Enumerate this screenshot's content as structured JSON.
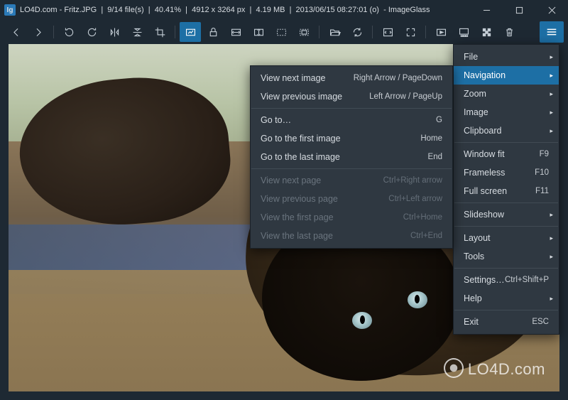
{
  "titlebar": {
    "site": "LO4D.com",
    "filename": "Fritz.JPG",
    "file_pos": "9/14 file(s)",
    "zoom": "40.41%",
    "dimensions": "4912 x 3264 px",
    "filesize": "4.19 MB",
    "datetime": "2013/06/15 08:27:01 (o)",
    "appname": "ImageGlass"
  },
  "main_menu": [
    {
      "label": "File",
      "arrow": true
    },
    {
      "label": "Navigation",
      "arrow": true,
      "selected": true
    },
    {
      "label": "Zoom",
      "arrow": true
    },
    {
      "label": "Image",
      "arrow": true
    },
    {
      "label": "Clipboard",
      "arrow": true
    },
    {
      "sep": true
    },
    {
      "label": "Window fit",
      "shortcut": "F9"
    },
    {
      "label": "Frameless",
      "shortcut": "F10"
    },
    {
      "label": "Full screen",
      "shortcut": "F11"
    },
    {
      "sep": true
    },
    {
      "label": "Slideshow",
      "arrow": true
    },
    {
      "sep": true
    },
    {
      "label": "Layout",
      "arrow": true
    },
    {
      "label": "Tools",
      "arrow": true
    },
    {
      "sep": true
    },
    {
      "label": "Settings…",
      "shortcut": "Ctrl+Shift+P"
    },
    {
      "label": "Help",
      "arrow": true
    },
    {
      "sep": true
    },
    {
      "label": "Exit",
      "shortcut": "ESC"
    }
  ],
  "sub_menu": [
    {
      "label": "View next image",
      "shortcut": "Right Arrow / PageDown"
    },
    {
      "label": "View previous image",
      "shortcut": "Left Arrow / PageUp"
    },
    {
      "sep": true
    },
    {
      "label": "Go to…",
      "shortcut": "G"
    },
    {
      "label": "Go to the first image",
      "shortcut": "Home"
    },
    {
      "label": "Go to the last image",
      "shortcut": "End"
    },
    {
      "sep": true
    },
    {
      "label": "View next page",
      "shortcut": "Ctrl+Right arrow",
      "disabled": true
    },
    {
      "label": "View previous page",
      "shortcut": "Ctrl+Left arrow",
      "disabled": true
    },
    {
      "label": "View the first page",
      "shortcut": "Ctrl+Home",
      "disabled": true
    },
    {
      "label": "View the last page",
      "shortcut": "Ctrl+End",
      "disabled": true
    }
  ],
  "watermark": "LO4D.com"
}
